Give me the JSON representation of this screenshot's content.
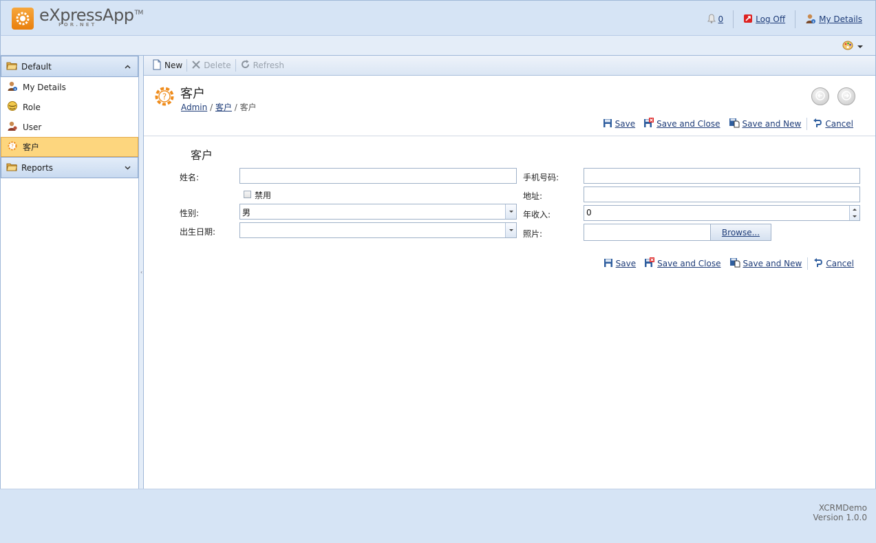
{
  "app": {
    "logo_text": "eXpressApp",
    "logo_tm": "TM",
    "logo_sub": "FOR.NET"
  },
  "header": {
    "notifications_count": "0",
    "logoff_label": "Log Off",
    "my_details_label": "My Details"
  },
  "nav": {
    "groups": [
      {
        "label": "Default",
        "expanded": true
      },
      {
        "label": "Reports",
        "expanded": false
      }
    ],
    "items": [
      {
        "label": "My Details",
        "icon": "user-info-icon"
      },
      {
        "label": "Role",
        "icon": "role-icon"
      },
      {
        "label": "User",
        "icon": "user-icon"
      },
      {
        "label": "客户",
        "icon": "customer-gear-icon",
        "selected": true
      }
    ]
  },
  "toolbar": {
    "new_label": "New",
    "delete_label": "Delete",
    "refresh_label": "Refresh"
  },
  "view": {
    "title": "客户",
    "breadcrumb": [
      "Admin",
      "客户",
      "客户"
    ]
  },
  "actions": {
    "save": "Save",
    "save_close": "Save and Close",
    "save_new": "Save and New",
    "cancel": "Cancel"
  },
  "form": {
    "title": "客户",
    "name_label": "姓名:",
    "name_value": "",
    "disabled_label": "禁用",
    "disabled_checked": false,
    "gender_label": "性别:",
    "gender_value": "男",
    "birthdate_label": "出生日期:",
    "birthdate_value": "",
    "phone_label": "手机号码:",
    "phone_value": "",
    "address_label": "地址:",
    "address_value": "",
    "income_label": "年收入:",
    "income_value": "0",
    "photo_label": "照片:",
    "browse_label": "Browse..."
  },
  "footer": {
    "app_name": "XCRMDemo",
    "version": "Version 1.0.0"
  },
  "colors": {
    "header_bg": "#d6e4f5",
    "selected_nav_bg": "#fdd67e",
    "link": "#1e3c78",
    "accent_orange": "#ef8c1c"
  }
}
